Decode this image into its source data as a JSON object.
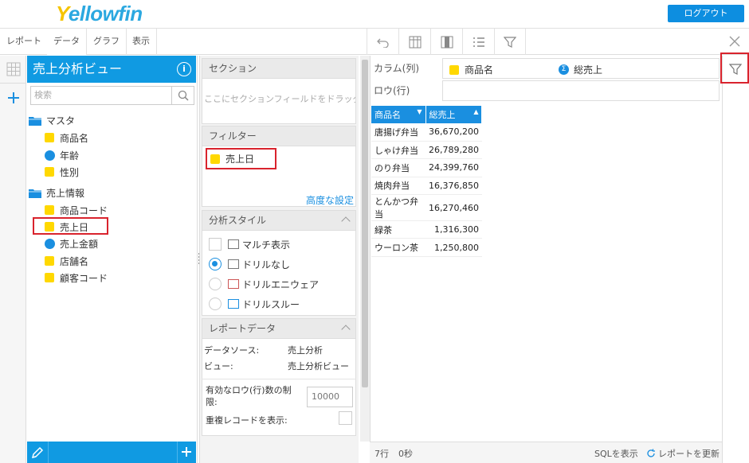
{
  "header": {
    "logo": "Yellowfin",
    "logout_label": "ログアウト"
  },
  "toolbar": {
    "tabs": [
      "レポート",
      "データ",
      "グラフ",
      "表示"
    ]
  },
  "data_panel": {
    "title": "売上分析ビュー",
    "search_placeholder": "検索",
    "folders": [
      {
        "label": "マスタ",
        "items": [
          {
            "label": "商品名",
            "kind": "dimension"
          },
          {
            "label": "年齢",
            "kind": "metric"
          },
          {
            "label": "性別",
            "kind": "dimension"
          }
        ]
      },
      {
        "label": "売上情報",
        "items": [
          {
            "label": "商品コード",
            "kind": "dimension"
          },
          {
            "label": "売上日",
            "kind": "dimension"
          },
          {
            "label": "売上金額",
            "kind": "metric"
          },
          {
            "label": "店舗名",
            "kind": "dimension"
          },
          {
            "label": "顧客コード",
            "kind": "dimension"
          }
        ]
      }
    ]
  },
  "sections": {
    "section_title": "セクション",
    "section_placeholder": "ここにセクションフィールドをドラッグ",
    "filter_title": "フィルター",
    "filter_item": "売上日",
    "advanced_link": "高度な設定",
    "style_title": "分析スタイル",
    "style_options": [
      "マルチ表示",
      "ドリルなし",
      "ドリルエニウェア",
      "ドリルスルー"
    ],
    "report_data_title": "レポートデータ",
    "datasource_label": "データソース:",
    "datasource_value": "売上分析",
    "view_label": "ビュー:",
    "view_value": "売上分析ビュー",
    "row_limit_label": "有効なロウ(行)数の制限:",
    "row_limit_value": "10000",
    "duplicates_label": "重複レコードを表示:"
  },
  "report": {
    "columns_label": "カラム(列)",
    "rows_label": "ロウ(行)",
    "column_fields": [
      "商品名",
      "総売上"
    ],
    "table_headers": [
      "商品名",
      "総売上"
    ],
    "rows": [
      [
        "唐揚げ弁当",
        "36,670,200"
      ],
      [
        "しゃけ弁当",
        "26,789,280"
      ],
      [
        "のり弁当",
        "24,399,760"
      ],
      [
        "焼肉弁当",
        "16,376,850"
      ],
      [
        "とんかつ弁当",
        "16,270,460"
      ],
      [
        "緑茶",
        "1,316,300"
      ],
      [
        "ウーロン茶",
        "1,250,800"
      ]
    ],
    "status_rows": "7行",
    "status_time": "0秒",
    "sql_link": "SQLを表示",
    "refresh_link": "レポートを更新"
  },
  "colors": {
    "accent": "#109ae2",
    "highlight": "#d9232d",
    "dimension": "#ffd800"
  }
}
